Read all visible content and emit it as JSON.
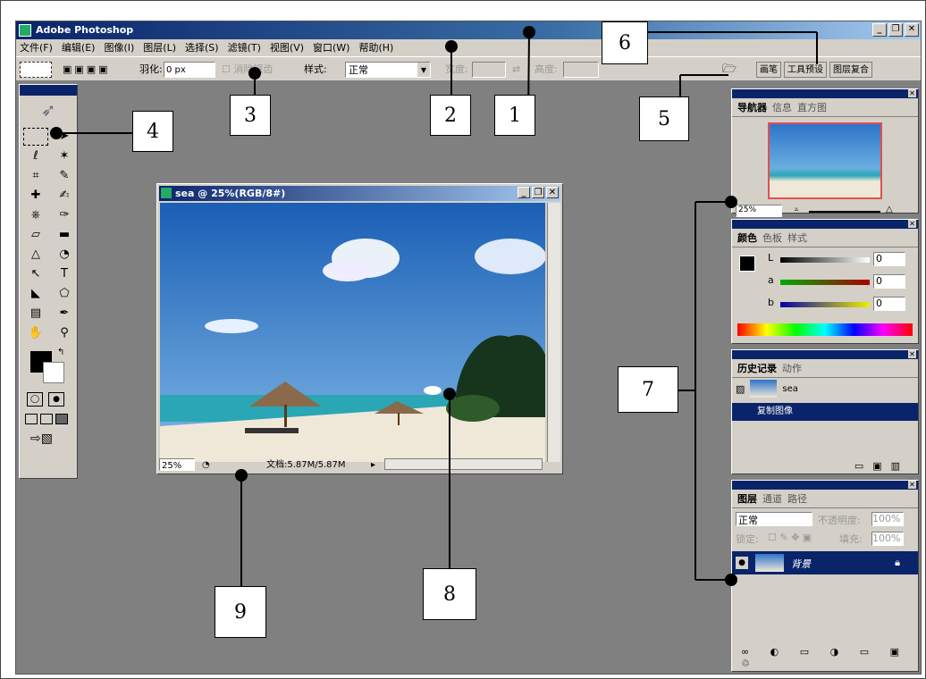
{
  "app": {
    "title": "Adobe Photoshop",
    "win_buttons": [
      "_",
      "❐",
      "✕"
    ]
  },
  "menu": [
    "文件(F)",
    "编辑(E)",
    "图像(I)",
    "图层(L)",
    "选择(S)",
    "滤镜(T)",
    "视图(V)",
    "窗口(W)",
    "帮助(H)"
  ],
  "options": {
    "feather_label": "羽化:",
    "feather_value": "0 px",
    "antialias": "消除锯齿",
    "style_label": "样式:",
    "style_value": "正常",
    "width_label": "宽度:",
    "height_label": "高度:",
    "dock_tabs": [
      "画笔",
      "工具预设",
      "图层复合"
    ]
  },
  "document": {
    "title": "sea @ 25%(RGB/8#)",
    "zoom": "25%",
    "doc_info": "文档:5.87M/5.87M"
  },
  "navigator": {
    "tabs": [
      "导航器",
      "信息",
      "直方图"
    ],
    "zoom": "25%"
  },
  "color": {
    "tabs": [
      "颜色",
      "色板",
      "样式"
    ],
    "channels": [
      {
        "label": "L",
        "value": "0"
      },
      {
        "label": "a",
        "value": "0"
      },
      {
        "label": "b",
        "value": "0"
      }
    ]
  },
  "history": {
    "tabs": [
      "历史记录",
      "动作"
    ],
    "snapshot": "sea",
    "step": "复制图像"
  },
  "layers": {
    "tabs": [
      "图层",
      "通道",
      "路径"
    ],
    "blend": "正常",
    "opacity_label": "不透明度:",
    "opacity_value": "100%",
    "lock_label": "锁定:",
    "fill_label": "填充:",
    "fill_value": "100%",
    "layer_name": "背景"
  },
  "callouts": [
    "1",
    "2",
    "3",
    "4",
    "5",
    "6",
    "7",
    "8",
    "9"
  ],
  "tool_icons": [
    "marquee-icon",
    "move-icon",
    "lasso-icon",
    "magic-wand-icon",
    "crop-icon",
    "slice-icon",
    "healing-icon",
    "brush-icon",
    "stamp-icon",
    "history-brush-icon",
    "eraser-icon",
    "gradient-icon",
    "blur-icon",
    "dodge-icon",
    "path-select-icon",
    "type-icon",
    "pen-icon",
    "shape-icon",
    "notes-icon",
    "eyedropper-icon",
    "hand-icon",
    "zoom-icon"
  ]
}
